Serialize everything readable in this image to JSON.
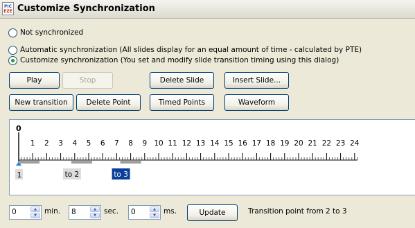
{
  "window": {
    "title": "Customize Synchronization",
    "icon_top": "PIC",
    "icon_bottom": "EZE"
  },
  "options": [
    {
      "label": "Not synchronized",
      "checked": false
    },
    {
      "label": "Automatic synchronization (All slides display for an equal amount of time - calculated by PTE)",
      "checked": false
    },
    {
      "label": "Customize synchronization (You set and modify slide transition timing using this dialog)",
      "checked": true
    }
  ],
  "buttons": {
    "play": "Play",
    "stop": "Stop",
    "delete_slide": "Delete Slide",
    "insert_slide": "Insert Slide...",
    "new_transition": "New transition",
    "delete_point": "Delete Point",
    "timed_points": "Timed Points",
    "waveform": "Waveform",
    "update": "Update"
  },
  "timeline": {
    "cursor_label": "0",
    "ticks": [
      "1",
      "2",
      "3",
      "4",
      "5",
      "6",
      "7",
      "8",
      "9",
      "10",
      "11",
      "12",
      "13",
      "14",
      "15",
      "16",
      "17",
      "18",
      "19",
      "20",
      "21",
      "22",
      "23",
      "24"
    ],
    "slide_start_label": "1",
    "markers": [
      {
        "label": "to 2",
        "selected": false,
        "time_sec": 4.5
      },
      {
        "label": "to 3",
        "selected": true,
        "time_sec": 8.0
      }
    ],
    "colors": {
      "selected": "#0a3f9a",
      "cursor": "#2a7fe0"
    }
  },
  "time_fields": {
    "min": {
      "value": "0",
      "unit": "min."
    },
    "sec": {
      "value": "8",
      "unit": "sec."
    },
    "ms": {
      "value": "0",
      "unit": "ms."
    }
  },
  "status_text": "Transition point from 2 to 3"
}
